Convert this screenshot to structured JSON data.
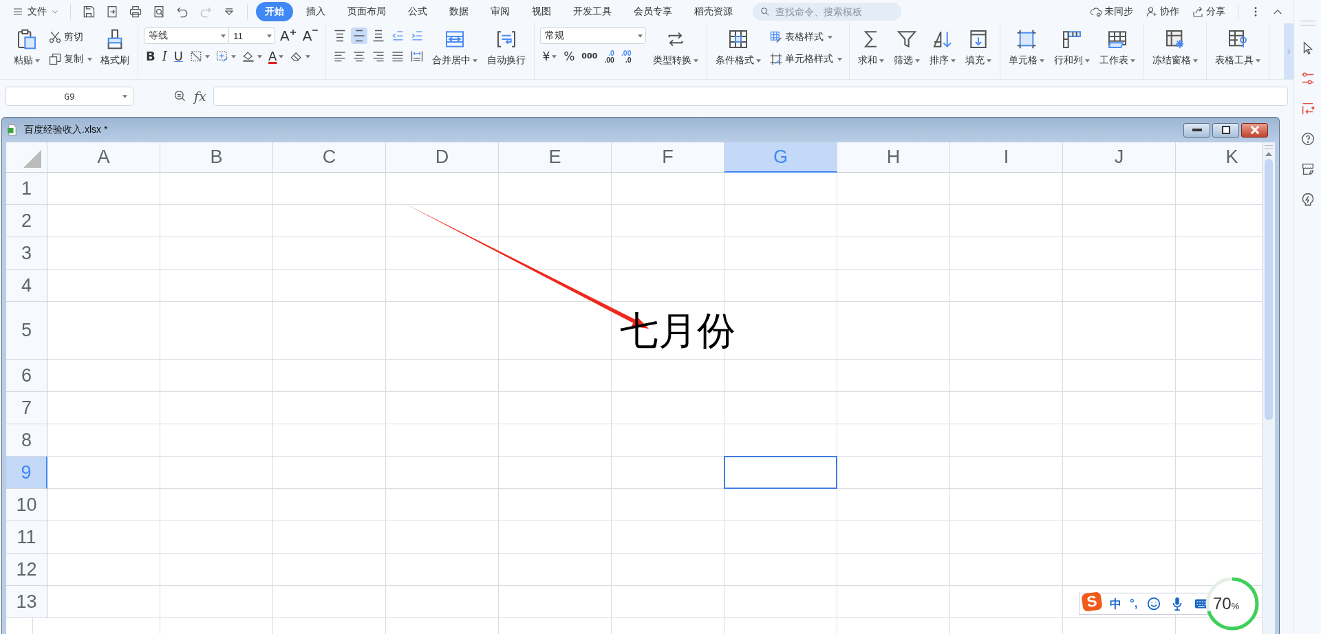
{
  "top_bar": {
    "file_menu": "文件",
    "tabs": [
      {
        "label": "开始",
        "selected": true
      },
      {
        "label": "插入",
        "selected": false
      },
      {
        "label": "页面布局",
        "selected": false
      },
      {
        "label": "公式",
        "selected": false
      },
      {
        "label": "数据",
        "selected": false
      },
      {
        "label": "审阅",
        "selected": false
      },
      {
        "label": "视图",
        "selected": false
      },
      {
        "label": "开发工具",
        "selected": false
      },
      {
        "label": "会员专享",
        "selected": false
      },
      {
        "label": "稻壳资源",
        "selected": false
      }
    ],
    "search": {
      "placeholder": "查找命令、搜索模板"
    },
    "actions": [
      "未同步",
      "协作",
      "分享"
    ]
  },
  "ribbon": {
    "groups": [
      {
        "items": [
          {
            "kind": "large",
            "label": "粘贴",
            "dropdown": true
          },
          {
            "kind": "stack",
            "items": [
              {
                "label": "剪切",
                "dropdown": false
              },
              {
                "label": "复制",
                "dropdown": true
              }
            ]
          },
          {
            "kind": "large",
            "label": "格式刷",
            "dropdown": false
          }
        ]
      },
      {
        "items": [
          {
            "kind": "panel",
            "top": [
              {
                "kind": "font_field",
                "value": "等线"
              },
              {
                "kind": "size_field",
                "value": "11"
              },
              {
                "kind": "grow",
                "text": "A"
              },
              {
                "kind": "shrink",
                "text": "A"
              }
            ],
            "bottom": [
              {
                "kind": "bold",
                "text": "B"
              },
              {
                "kind": "italic",
                "text": "I"
              },
              {
                "kind": "underline",
                "text": "U"
              },
              {
                "kind": "icon",
                "dropdown": true
              },
              {
                "kind": "icon",
                "dropdown": true
              },
              {
                "kind": "icon",
                "dropdown": true
              },
              {
                "kind": "font_color",
                "text": "A",
                "dropdown": true
              },
              {
                "kind": "icon",
                "dropdown": true
              }
            ]
          }
        ]
      },
      {
        "items": [
          {
            "kind": "panel",
            "top": [
              {
                "kind": "icon",
                "selected": false
              },
              {
                "kind": "icon",
                "selected": true
              },
              {
                "kind": "icon",
                "selected": false
              },
              {
                "kind": "icon",
                "selected": false
              },
              {
                "kind": "icon",
                "selected": false
              }
            ],
            "bottom": [
              {
                "kind": "icon",
                "selected": false
              },
              {
                "kind": "icon",
                "selected": false
              },
              {
                "kind": "icon",
                "selected": false
              },
              {
                "kind": "icon",
                "selected": false
              },
              {
                "kind": "icon",
                "selected": false
              }
            ]
          },
          {
            "kind": "large",
            "label": "合并居中",
            "dropdown": true
          },
          {
            "kind": "large",
            "label": "自动换行",
            "dropdown": false
          }
        ]
      },
      {
        "items": [
          {
            "kind": "panel",
            "top": [
              {
                "kind": "format_field",
                "value": "常规"
              }
            ],
            "bottom": [
              {
                "kind": "currency",
                "text": "¥",
                "dropdown": true
              },
              {
                "kind": "percent",
                "text": "%"
              },
              {
                "kind": "thousands",
                "text": "000"
              },
              {
                "kind": "decimal",
                "top": ".0",
                "bottom": ".00"
              },
              {
                "kind": "decimal",
                "top": ".00",
                "bottom": ".0"
              }
            ]
          },
          {
            "kind": "large",
            "label": "类型转换",
            "dropdown": true
          }
        ]
      },
      {
        "items": [
          {
            "kind": "large",
            "label": "条件格式",
            "dropdown": true
          },
          {
            "kind": "stack",
            "items": [
              {
                "label": "表格样式",
                "dropdown": true
              },
              {
                "label": "单元格样式",
                "dropdown": true
              }
            ]
          }
        ]
      },
      {
        "items": [
          {
            "kind": "large",
            "label": "求和",
            "dropdown": true
          },
          {
            "kind": "large",
            "label": "筛选",
            "dropdown": true
          },
          {
            "kind": "large",
            "label": "排序",
            "dropdown": true
          },
          {
            "kind": "large",
            "label": "填充",
            "dropdown": true
          }
        ]
      },
      {
        "items": [
          {
            "kind": "large",
            "label": "单元格",
            "dropdown": true
          },
          {
            "kind": "large",
            "label": "行和列",
            "dropdown": true
          },
          {
            "kind": "large",
            "label": "工作表",
            "dropdown": true
          }
        ]
      },
      {
        "items": [
          {
            "kind": "large",
            "label": "冻结窗格",
            "dropdown": true
          }
        ]
      },
      {
        "items": [
          {
            "kind": "large",
            "label": "表格工具",
            "dropdown": true
          }
        ]
      }
    ]
  },
  "formula_bar": {
    "name_box": "G9",
    "fx": "fx"
  },
  "document": {
    "title": "百度经验收入.xlsx *",
    "columns": [
      {
        "label": "A",
        "selected": false
      },
      {
        "label": "B",
        "selected": false
      },
      {
        "label": "C",
        "selected": false
      },
      {
        "label": "D",
        "selected": false
      },
      {
        "label": "E",
        "selected": false
      },
      {
        "label": "F",
        "selected": false
      },
      {
        "label": "G",
        "selected": true
      },
      {
        "label": "H",
        "selected": false
      },
      {
        "label": "I",
        "selected": false
      },
      {
        "label": "J",
        "selected": false
      },
      {
        "label": "K",
        "selected": false
      }
    ],
    "rows": [
      {
        "label": "1",
        "selected": false
      },
      {
        "label": "2",
        "selected": false
      },
      {
        "label": "3",
        "selected": false
      },
      {
        "label": "4",
        "selected": false
      },
      {
        "label": "5",
        "selected": false,
        "cells": [
          null,
          null,
          null,
          null,
          null,
          "七月份"
        ]
      },
      {
        "label": "6",
        "selected": false
      },
      {
        "label": "7",
        "selected": false
      },
      {
        "label": "8",
        "selected": false
      },
      {
        "label": "9",
        "selected": true
      },
      {
        "label": "10",
        "selected": false
      },
      {
        "label": "11",
        "selected": false
      },
      {
        "label": "12",
        "selected": false
      },
      {
        "label": "13",
        "selected": false
      }
    ]
  },
  "ime_bar": {
    "logo": "S",
    "mode": "中",
    "punctuation": "°,"
  },
  "gauge": {
    "value": "70",
    "unit": "%",
    "level": 0.7
  }
}
